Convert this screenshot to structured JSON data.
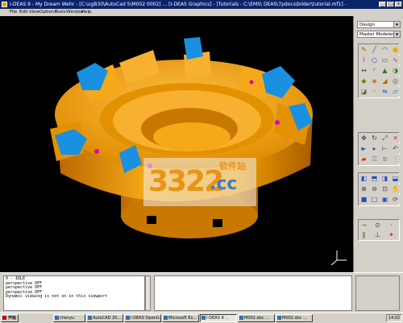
{
  "window": {
    "title": "I-DEAS 9 - My Dream Wehr - [C:\\ugB30\\AutoCad 5\\M002 0002] ... [I-DEAS Graphics] - [Tutorials - C:\\EMS\\ DEAS\\7pdocs\\bilder\\tutorial.mf1] - [I-DEAS Graphics]",
    "controls": {
      "minimize": "_",
      "maximize": "□",
      "close": "×"
    }
  },
  "menu": [
    "File",
    "Edit",
    "View",
    "Options",
    "Tools",
    "Window",
    "Help"
  ],
  "side_panel": {
    "task_select": "Design",
    "subtask_select": "Master Modeler"
  },
  "console": {
    "lines": [
      "0 - IDLE",
      "perspective OFF",
      "perspective OFF",
      "perspective OFF",
      "Dynamic viewing is not on in this viewport"
    ]
  },
  "watermark": {
    "number": "3322",
    "suffix": ".cc",
    "cn": "软件站"
  },
  "taskbar": {
    "start": "开始",
    "buttons": [
      "chenyu",
      "AutoCAD 20...",
      "I-DEAS OpenG...",
      "Microsoft Ex...",
      "I-DEAS 9 ...",
      "M002.doc ...",
      "M002.doc ..."
    ],
    "clock": "14:02"
  },
  "colors": {
    "part": "#f0a000",
    "insert": "#1a90e0",
    "marker": "#e000c0",
    "viewport_bg": "#000000",
    "titlebar": "#0a246a"
  }
}
